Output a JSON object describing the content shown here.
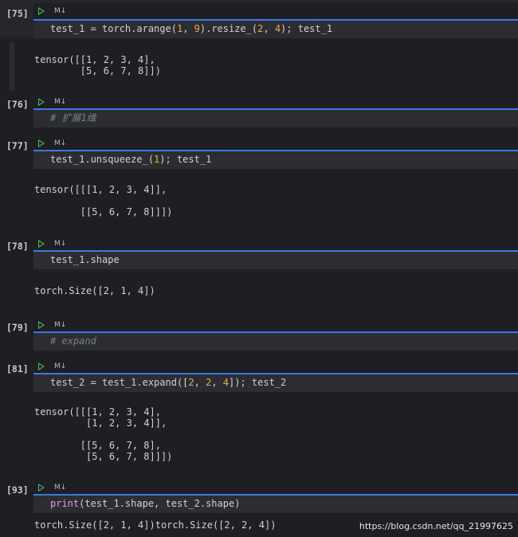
{
  "notebook": {
    "cells": [
      {
        "id": "c75",
        "exec_label": "[75]",
        "kind_label": "M↓",
        "code_html": "test_1 = torch.arange(<span class=\"num\">1</span>, <span class=\"num\">9</span>).resize_(<span class=\"num\">2</span>, <span class=\"num\">4</span>); test_1",
        "output": "tensor([[1, 2, 3, 4],\n        [5, 6, 7, 8]])"
      },
      {
        "id": "c76",
        "exec_label": "[76]",
        "kind_label": "M↓",
        "code_html": "<span class=\"comment\"># 扩展1维</span>",
        "output": ""
      },
      {
        "id": "c77",
        "exec_label": "[77]",
        "kind_label": "M↓",
        "code_html": "test_1.unsqueeze_(<span class=\"num\">1</span>); test_1",
        "output": "tensor([[[1, 2, 3, 4]],\n\n        [[5, 6, 7, 8]]])"
      },
      {
        "id": "c78",
        "exec_label": "[78]",
        "kind_label": "M↓",
        "code_html": "test_1.shape",
        "output": "torch.Size([2, 1, 4])"
      },
      {
        "id": "c79",
        "exec_label": "[79]",
        "kind_label": "M↓",
        "code_html": "<span class=\"comment\"># expand</span>",
        "output": ""
      },
      {
        "id": "c81",
        "exec_label": "[81]",
        "kind_label": "M↓",
        "code_html": "test_2 = test_1.expand([<span class=\"num\">2</span>, <span class=\"num\">2</span>, <span class=\"num\">4</span>]); test_2",
        "output": "tensor([[[1, 2, 3, 4],\n         [1, 2, 3, 4]],\n\n        [[5, 6, 7, 8],\n         [5, 6, 7, 8]]])"
      },
      {
        "id": "c93",
        "exec_label": "[93]",
        "kind_label": "M↓",
        "code_html": "<span class=\"fn\">print</span>(test_1.shape, test_2.shape)",
        "output": "torch.Size([2, 1, 4])torch.Size([2, 2, 4])"
      }
    ]
  },
  "watermark": "https://blog.csdn.net/qq_21997625"
}
